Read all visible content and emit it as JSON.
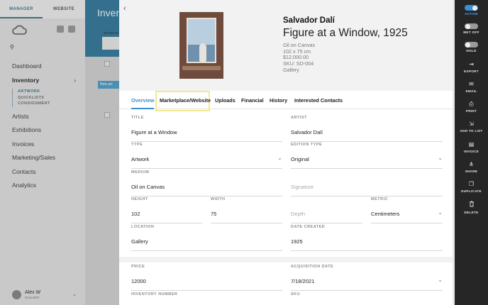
{
  "sidebar": {
    "tabs": [
      "MANAGER",
      "WEBSITE"
    ],
    "nav": [
      "Dashboard",
      "Inventory",
      "Artists",
      "Exhibitions",
      "Invoices",
      "Marketing/Sales",
      "Contacts",
      "Analytics"
    ],
    "inventory_sub": [
      "ARTWORK",
      "QUICKLISTS",
      "CONSIGNMENT"
    ],
    "user": {
      "name": "Alex W",
      "subtitle": "GALLERY"
    }
  },
  "background": {
    "title": "Inventory",
    "search_label": "SEARCH",
    "search_placeholder": "Te",
    "new_button": "New art"
  },
  "detail": {
    "artist": "Salvador Dalí",
    "title": "Figure at a Window, 1925",
    "meta": [
      "Oil on Canvas",
      "102 x 75 cm",
      "$12,000.00",
      "SKU: SD-004",
      "Gallery"
    ],
    "tabs": [
      "Overview",
      "Marketplace/Website",
      "Uploads",
      "Financial",
      "History",
      "Interested Contacts"
    ],
    "active_tab": "Overview",
    "highlighted_tab": "Marketplace/Website",
    "fields": {
      "title": {
        "label": "TITLE",
        "value": "Figure at a Window"
      },
      "artist": {
        "label": "ARTIST",
        "value": "Salvador Dalí"
      },
      "type": {
        "label": "TYPE",
        "value": "Artwork"
      },
      "edition_type": {
        "label": "EDITION TYPE",
        "value": "Original"
      },
      "medium": {
        "label": "MEDIUM",
        "value": "Oil on Canvas"
      },
      "signature": {
        "label": "",
        "placeholder": "Signature"
      },
      "height": {
        "label": "HEIGHT",
        "value": "102"
      },
      "width": {
        "label": "WIDTH",
        "value": "75"
      },
      "depth": {
        "label": "",
        "placeholder": "Depth"
      },
      "metric": {
        "label": "METRIC",
        "value": "Centimeters"
      },
      "location": {
        "label": "LOCATION",
        "value": "Gallery"
      },
      "date_created": {
        "label": "DATE CREATED",
        "value": "1925"
      },
      "price": {
        "label": "PRICE",
        "value": "12000"
      },
      "acquisition_date": {
        "label": "ACQUISITION DATE",
        "value": "7/18/2021"
      },
      "inventory_number": {
        "label": "INVENTORY NUMBER",
        "value": ""
      },
      "sku": {
        "label": "SKU",
        "value": ""
      }
    }
  },
  "actions": [
    {
      "label": "ACTIVE",
      "kind": "toggle",
      "state": "on",
      "icon": "toggle-icon"
    },
    {
      "label": "MKT OFF",
      "kind": "toggle",
      "state": "off",
      "icon": "toggle-icon"
    },
    {
      "label": "HOLD",
      "kind": "toggle",
      "state": "off",
      "icon": "toggle-icon"
    },
    {
      "label": "EXPORT",
      "kind": "button",
      "icon": "export-icon",
      "glyph": "⇥"
    },
    {
      "label": "EMAIL",
      "kind": "button",
      "icon": "email-icon",
      "glyph": "✉"
    },
    {
      "label": "PRINT",
      "kind": "button",
      "icon": "print-icon",
      "glyph": "⎙"
    },
    {
      "label": "ADD TO LIST",
      "kind": "button",
      "icon": "add-to-list-icon",
      "glyph": "⇲"
    },
    {
      "label": "INVOICE",
      "kind": "button",
      "icon": "invoice-icon",
      "glyph": "▤"
    },
    {
      "label": "SHARE",
      "kind": "button",
      "icon": "share-icon",
      "glyph": "⋔"
    },
    {
      "label": "DUPLICATE",
      "kind": "button",
      "icon": "duplicate-icon",
      "glyph": "❐"
    },
    {
      "label": "DELETE",
      "kind": "button",
      "icon": "delete-icon",
      "glyph": "🗑"
    }
  ],
  "colors": {
    "accent": "#3b8fd6",
    "highlight": "#f1ea8e",
    "action_bar": "#262626",
    "header_blue": "#34708d"
  }
}
